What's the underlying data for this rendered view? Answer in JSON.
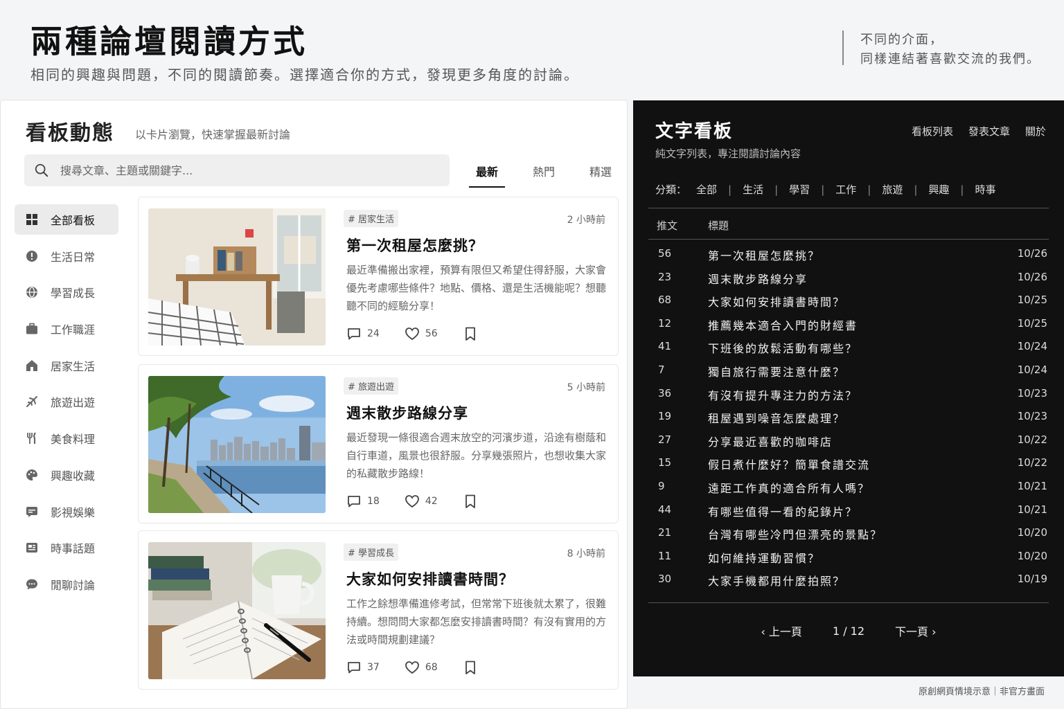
{
  "hero": {
    "title": "兩種論壇閱讀方式",
    "subtitle": "相同的興趣與問題，不同的閱讀節奏。選擇適合你的方式，發現更多角度的討論。",
    "quote_line1": "不同的介面，",
    "quote_line2": "同樣連結著喜歡交流的我們。"
  },
  "card_view": {
    "title": "看板動態",
    "subtitle": "以卡片瀏覽，快速掌握最新討論",
    "search_placeholder": "搜尋文章、主題或關鍵字...",
    "tabs": [
      "最新",
      "熱門",
      "精選"
    ],
    "active_tab": "最新",
    "sidebar": [
      {
        "label": "全部看板",
        "icon": "grid-icon",
        "active": true
      },
      {
        "label": "生活日常",
        "icon": "info-icon"
      },
      {
        "label": "學習成長",
        "icon": "globe-icon"
      },
      {
        "label": "工作職涯",
        "icon": "briefcase-icon"
      },
      {
        "label": "居家生活",
        "icon": "home-icon"
      },
      {
        "label": "旅遊出遊",
        "icon": "plane-icon"
      },
      {
        "label": "美食料理",
        "icon": "utensils-icon"
      },
      {
        "label": "興趣收藏",
        "icon": "palette-icon"
      },
      {
        "label": "影視娛樂",
        "icon": "film-icon"
      },
      {
        "label": "時事話題",
        "icon": "news-icon"
      },
      {
        "label": "閒聊討論",
        "icon": "chat-icon"
      }
    ],
    "posts": [
      {
        "tag": "# 居家生活",
        "time": "2 小時前",
        "title": "第一次租屋怎麼挑？",
        "excerpt": "最近準備搬出家裡，預算有限但又希望住得舒服，大家會優先考慮哪些條件？地點、價格、還是生活機能呢？想聽聽不同的經驗分享！",
        "comments": "24",
        "likes": "56"
      },
      {
        "tag": "# 旅遊出遊",
        "time": "5 小時前",
        "title": "週末散步路線分享",
        "excerpt": "最近發現一條很適合週末放空的河濱步道，沿途有樹蔭和自行車道，風景也很舒服。分享幾張照片，也想收集大家的私藏散步路線！",
        "comments": "18",
        "likes": "42"
      },
      {
        "tag": "# 學習成長",
        "time": "8 小時前",
        "title": "大家如何安排讀書時間？",
        "excerpt": "工作之餘想準備進修考試，但常常下班後就太累了，很難持續。想問問大家都怎麼安排讀書時間？有沒有實用的方法或時間規劃建議？",
        "comments": "37",
        "likes": "68"
      }
    ]
  },
  "text_view": {
    "title": "文字看板",
    "subtitle": "純文字列表，專注閱讀討論內容",
    "nav": [
      "看板列表",
      "發表文章",
      "關於"
    ],
    "category_label": "分類：",
    "categories": [
      "全部",
      "生活",
      "學習",
      "工作",
      "旅遊",
      "興趣",
      "時事"
    ],
    "col_push": "推文",
    "col_title": "標題",
    "rows": [
      {
        "n": "56",
        "t": "第一次租屋怎麼挑？",
        "d": "10/26"
      },
      {
        "n": "23",
        "t": "週末散步路線分享",
        "d": "10/26"
      },
      {
        "n": "68",
        "t": "大家如何安排讀書時間？",
        "d": "10/25"
      },
      {
        "n": "12",
        "t": "推薦幾本適合入門的財經書",
        "d": "10/25"
      },
      {
        "n": "41",
        "t": "下班後的放鬆活動有哪些？",
        "d": "10/24"
      },
      {
        "n": "7",
        "t": "獨自旅行需要注意什麼？",
        "d": "10/24"
      },
      {
        "n": "36",
        "t": "有沒有提升專注力的方法？",
        "d": "10/23"
      },
      {
        "n": "19",
        "t": "租屋遇到噪音怎麼處理？",
        "d": "10/23"
      },
      {
        "n": "27",
        "t": "分享最近喜歡的咖啡店",
        "d": "10/22"
      },
      {
        "n": "15",
        "t": "假日煮什麼好？簡單食譜交流",
        "d": "10/22"
      },
      {
        "n": "9",
        "t": "遠距工作真的適合所有人嗎？",
        "d": "10/21"
      },
      {
        "n": "44",
        "t": "有哪些值得一看的紀錄片？",
        "d": "10/21"
      },
      {
        "n": "21",
        "t": "台灣有哪些冷門但漂亮的景點？",
        "d": "10/20"
      },
      {
        "n": "11",
        "t": "如何維持運動習慣？",
        "d": "10/20"
      },
      {
        "n": "30",
        "t": "大家手機都用什麼拍照？",
        "d": "10/19"
      }
    ],
    "prev": "‹  上一頁",
    "page": "1 / 12",
    "next": "下一頁  ›"
  },
  "footer": "原創網頁情境示意｜非官方畫面"
}
